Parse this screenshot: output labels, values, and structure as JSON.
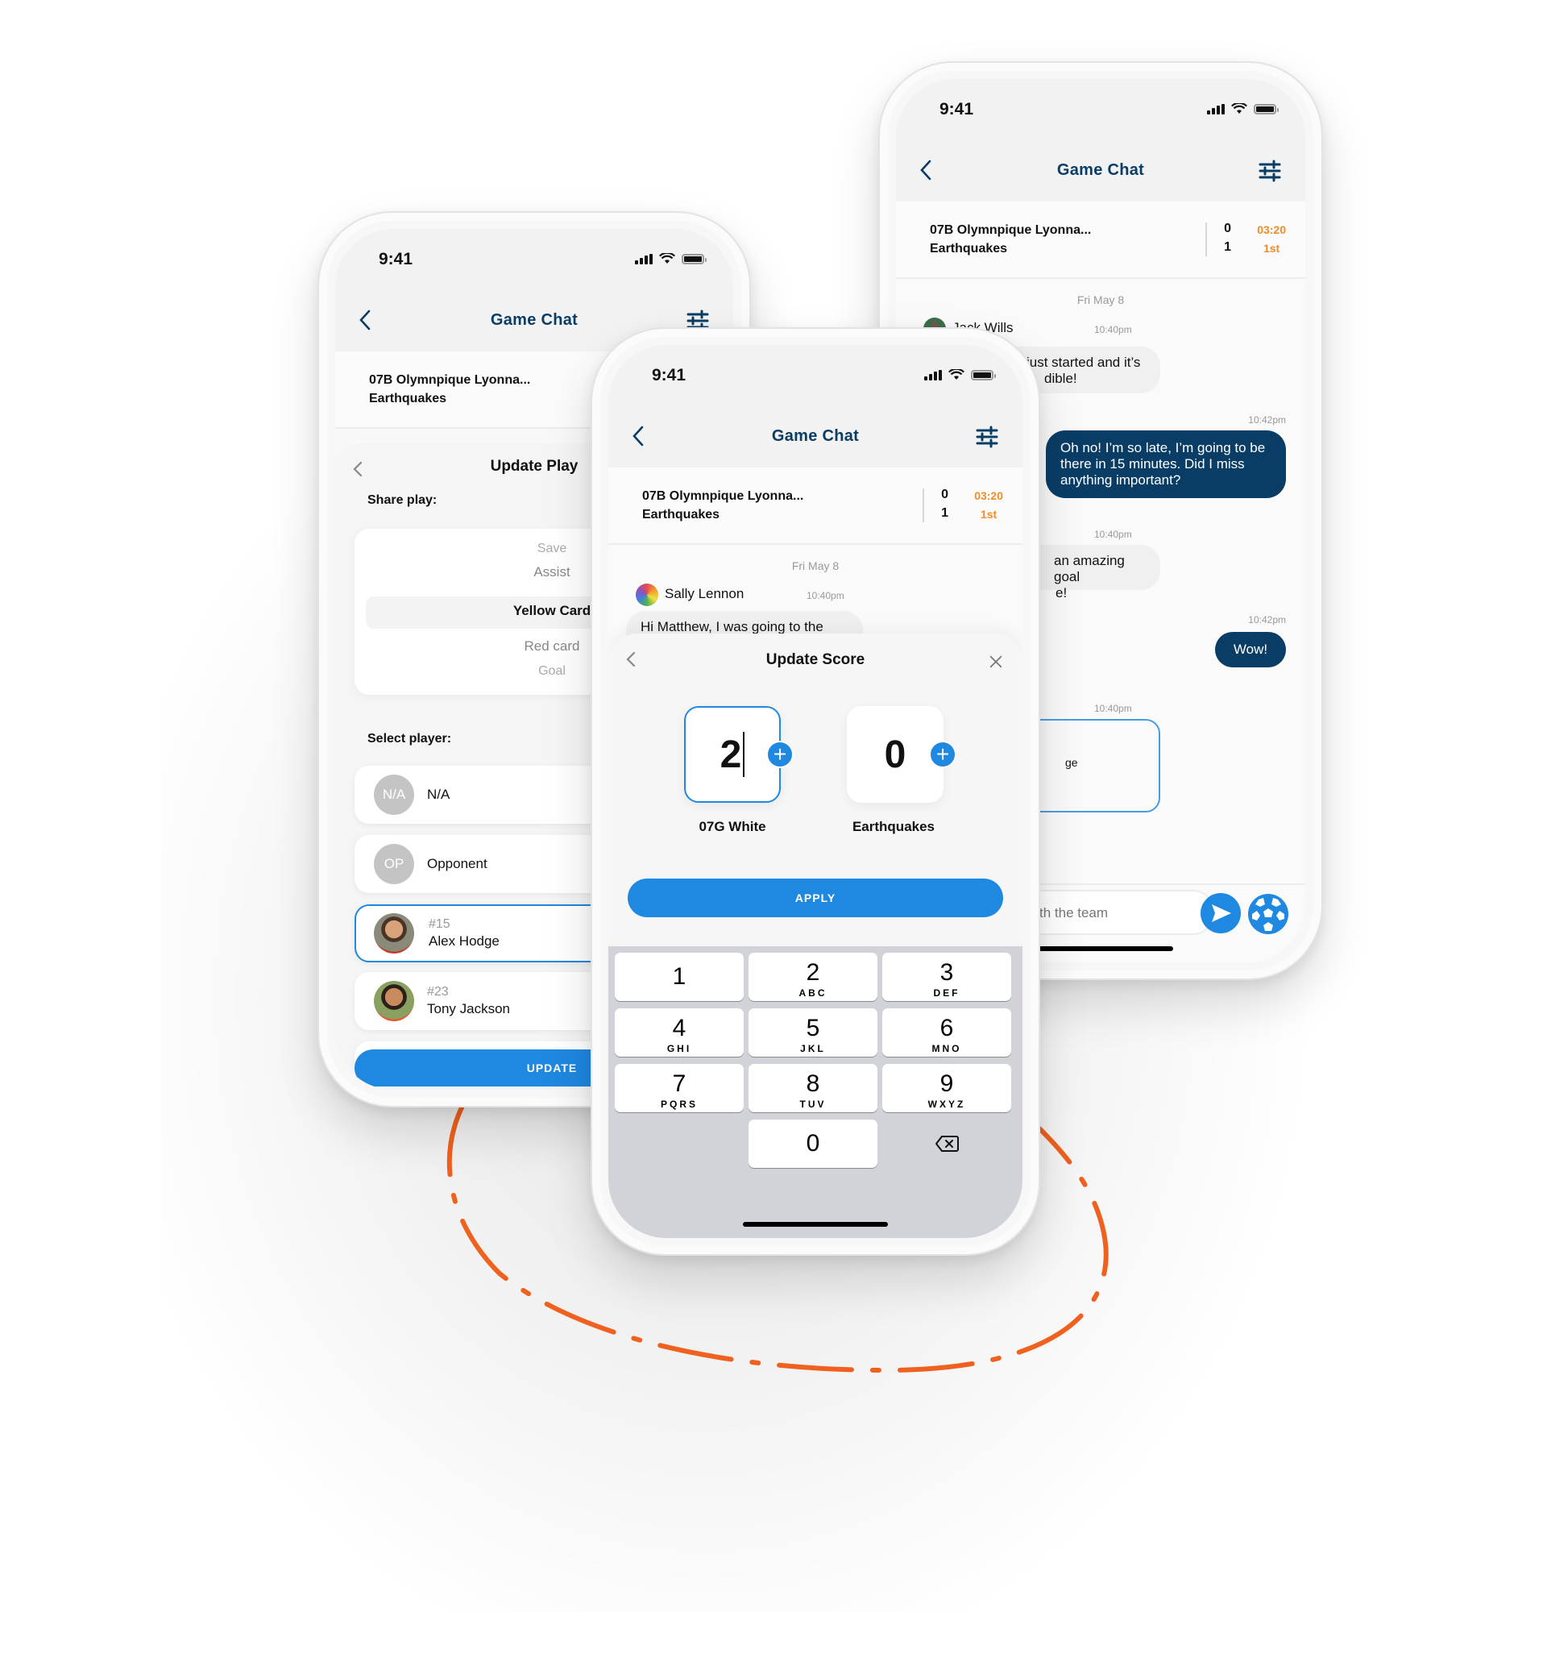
{
  "status_bar": {
    "time": "9:41"
  },
  "colors": {
    "brand_navy": "#0a3d66",
    "accent_blue": "#1f88e0",
    "clock_orange": "#f28c28",
    "dash_orange": "#f0601e"
  },
  "game": {
    "title": "Game Chat",
    "home_team": "07B Olymnpique Lyonna...",
    "away_team": "Earthquakes",
    "home_score": "0",
    "away_score": "1",
    "clock": "03:20",
    "period": "1st"
  },
  "right_phone": {
    "date": "Fri May 8",
    "messages": [
      {
        "sender": "Jack Wills",
        "time": "10:40pm",
        "text": "...just started and it's incredible!",
        "visible_line1": "just started and it’s",
        "visible_line2": "dible!",
        "direction": "in"
      },
      {
        "time": "10:42pm",
        "text": "Oh no! I’m so late, I’m going to be there in 15 minutes. Did I miss anything important?",
        "direction": "out"
      },
      {
        "time": "10:40pm",
        "visible_line1": "an amazing goal",
        "visible_line2": "e!",
        "direction": "in"
      },
      {
        "time": "10:42pm",
        "text": "Wow!",
        "direction": "out"
      },
      {
        "time": "10:40pm",
        "visible_text": "ge",
        "direction": "in-card"
      }
    ],
    "composer_placeholder": "th the team",
    "icons": {
      "send": "send-icon",
      "ball": "soccer-ball-icon"
    }
  },
  "left_phone": {
    "sheet_title": "Update Play",
    "share_label": "Share play:",
    "play_options": [
      "Save",
      "Assist",
      "Yellow Card",
      "Red card",
      "Goal"
    ],
    "selected_play": "Yellow Card",
    "select_player_label": "Select player:",
    "players": [
      {
        "initials": "N/A",
        "name": "N/A",
        "number": ""
      },
      {
        "initials": "OP",
        "name": "Opponent",
        "number": ""
      },
      {
        "initials": "",
        "name": "Alex Hodge",
        "number": "#15",
        "selected": true
      },
      {
        "initials": "",
        "name": "Tony Jackson",
        "number": "#23"
      }
    ],
    "update_label": "UPDATE"
  },
  "center_phone": {
    "date": "Fri May 8",
    "message": {
      "sender": "Sally Lennon",
      "time": "10:40pm",
      "text": "Hi Matthew, I was going to the"
    },
    "sheet_title": "Update Score",
    "team_a": {
      "name": "07G White",
      "score": "2"
    },
    "team_b": {
      "name": "Earthquakes",
      "score": "0"
    },
    "apply_label": "APPLY",
    "keys": [
      {
        "num": "1",
        "letters": ""
      },
      {
        "num": "2",
        "letters": "ABC"
      },
      {
        "num": "3",
        "letters": "DEF"
      },
      {
        "num": "4",
        "letters": "GHI"
      },
      {
        "num": "5",
        "letters": "JKL"
      },
      {
        "num": "6",
        "letters": "MNO"
      },
      {
        "num": "7",
        "letters": "PQRS"
      },
      {
        "num": "8",
        "letters": "TUV"
      },
      {
        "num": "9",
        "letters": "WXYZ"
      },
      {
        "num": "0",
        "letters": ""
      }
    ]
  }
}
